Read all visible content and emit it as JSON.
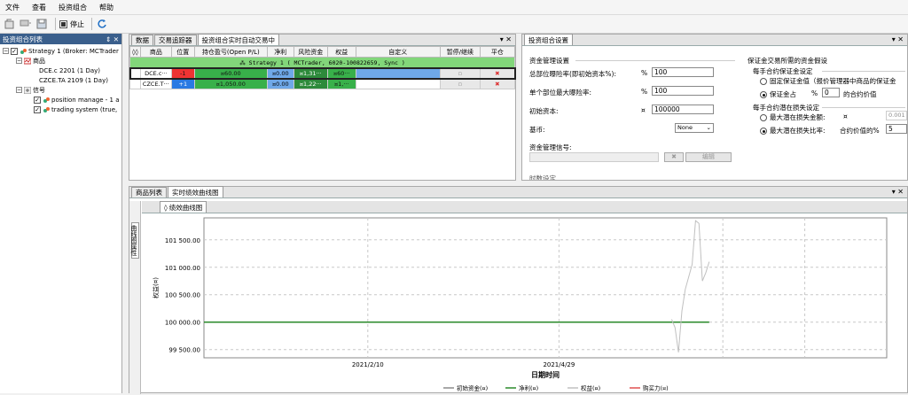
{
  "menu": {
    "items": [
      "文件",
      "查看",
      "投资组合",
      "帮助"
    ]
  },
  "toolbar": {
    "stop_label": "停止"
  },
  "left_panel": {
    "title": "投资组合列表",
    "pin": "⇕ ✕",
    "tree": [
      {
        "label": "Strategy 1 (Broker: MCTrader",
        "level": 0
      },
      {
        "label": "商品",
        "level": 1
      },
      {
        "label": "DCE.c 2201 (1 Day)",
        "level": 2
      },
      {
        "label": "CZCE.TA 2109 (1 Day)",
        "level": 2
      },
      {
        "label": "信号",
        "level": 1
      },
      {
        "label": "position manage - 1 a",
        "level": 2
      },
      {
        "label": "trading system (true,",
        "level": 2
      }
    ]
  },
  "top_tabs": {
    "items": [
      "数据",
      "交易追踪器",
      "投资组合实时自动交易中"
    ],
    "ctrl": "▾ ✕"
  },
  "grid": {
    "headers": [
      "商品",
      "位置",
      "持仓盈亏(Open P/L)",
      "净利",
      "风险资金",
      "权益",
      "自定义",
      "暂停/继续",
      "平仓"
    ],
    "strategy_row": "Strategy 1 ( MCTrader, 6020-100822659, Sync )",
    "rows": [
      {
        "symbol": "DCE.c···",
        "position": "-1",
        "open_pl": "¤60.00",
        "net": "¤0.00",
        "risk": "¤1,31···",
        "equity": "¤60···",
        "custom": "",
        "pause": "▫",
        "close": "✖"
      },
      {
        "symbol": "CZCE.T···",
        "position": "+1",
        "open_pl": "¤1,050.00",
        "net": "¤0.00",
        "risk": "¤1,22···",
        "equity": "¤1,···",
        "custom": "",
        "pause": "▫",
        "close": "✖"
      }
    ]
  },
  "settings": {
    "tab": "投资组合设置",
    "ctrl": "▾ ✕",
    "section": "资金管理设置",
    "exposure_label": "总部位曝险率(即初始资本%):",
    "exposure_unit": "%",
    "exposure_value": "100",
    "max_exposure_label": "单个部位最大曝险率:",
    "max_exposure_unit": "%",
    "max_exposure_value": "100",
    "init_capital_label": "初始资本:",
    "init_capital_unit": "¤",
    "init_capital_value": "100000",
    "currency_label": "基币:",
    "currency_value": "None",
    "signal_label": "资金管理信号:",
    "signal_btn_x": "✖",
    "signal_btn_edit": "编辑",
    "cutoff_text": "时数设定",
    "margin_title": "保证金交易所需的资金假设",
    "margin_sub1": "每手合约保证金设定",
    "opt_fixed": "固定保证金值（报价管理器中商品的保证金",
    "opt_percent": "保证金占",
    "opt_percent_unit": "%",
    "opt_percent_value": "0",
    "opt_percent_tail": "的合约价值",
    "margin_sub2": "每手合约潜在损失设定",
    "opt_max_amount": "最大潜在损失金额:",
    "opt_max_amount_unit": "¤",
    "opt_max_amount_value": "0.001",
    "opt_max_ratio": "最大潜在损失比率:",
    "opt_max_ratio_tail": "合约价值的%",
    "opt_max_ratio_value": "5"
  },
  "bottom_tabs": {
    "items": [
      "商品列表",
      "实时绩效曲线图"
    ],
    "ctrl": "▾ ✕"
  },
  "vertical_tab": "曲线图属性",
  "chart_tab": "绩效曲线图",
  "chart_data": {
    "type": "line",
    "xlabel": "日期时间",
    "ylabel": "权益(¤)",
    "yticks": [
      "101 500.00",
      "101 000.00",
      "100 500.00",
      "100 000.00",
      "99 500.00"
    ],
    "ytick_values": [
      101500,
      101000,
      100500,
      100000,
      99500
    ],
    "ylim": [
      99350,
      101900
    ],
    "xticks": [
      "2021/2/10",
      "2021/4/29"
    ],
    "xtick_pos": [
      0.24,
      0.52
    ],
    "grid": true,
    "legend_position": "bottom",
    "series": [
      {
        "name": "初始资金(¤)",
        "color": "#8a8a8a",
        "x": [
          0,
          0.74
        ],
        "y": [
          100000,
          100000
        ]
      },
      {
        "name": "净利(¤)",
        "color": "#2a8a2a",
        "x": [
          0,
          0.74
        ],
        "y": [
          100000,
          100000
        ]
      },
      {
        "name": "权益(¤)",
        "color": "#c0c0c0",
        "x": [
          0.685,
          0.69,
          0.695,
          0.7,
          0.705,
          0.715,
          0.72,
          0.725,
          0.73,
          0.735,
          0.74
        ],
        "y": [
          100050,
          99900,
          99450,
          100200,
          100600,
          101050,
          101850,
          101800,
          100750,
          100900,
          101100
        ]
      },
      {
        "name": "购买力(¤)",
        "color": "#e05050",
        "x": [],
        "y": []
      }
    ]
  }
}
